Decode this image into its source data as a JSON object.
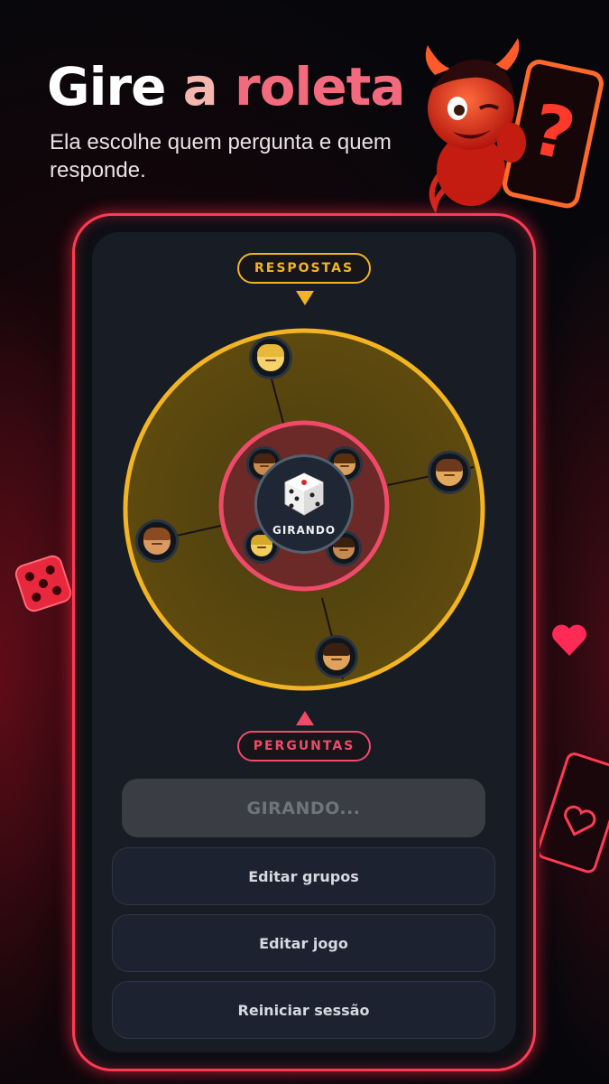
{
  "headline": {
    "word1": "Gire",
    "word2": "a",
    "word3": "roleta"
  },
  "subtitle": "Ela escolhe quem pergunta e quem responde.",
  "wheel": {
    "top_label": "RESPOSTAS",
    "bottom_label": "PERGUNTAS",
    "hub_label": "GIRANDO",
    "outer_color": "#f2b420",
    "inner_color": "#f04a6a"
  },
  "buttons": {
    "spin": "GIRANDO...",
    "edit_groups": "Editar grupos",
    "edit_game": "Editar jogo",
    "restart": "Reiniciar sessão"
  },
  "decorations": {
    "devil_card_symbol": "?",
    "icons": [
      "devil-mascot-icon",
      "dice-icon",
      "heart-icon",
      "heart-card-icon"
    ]
  }
}
